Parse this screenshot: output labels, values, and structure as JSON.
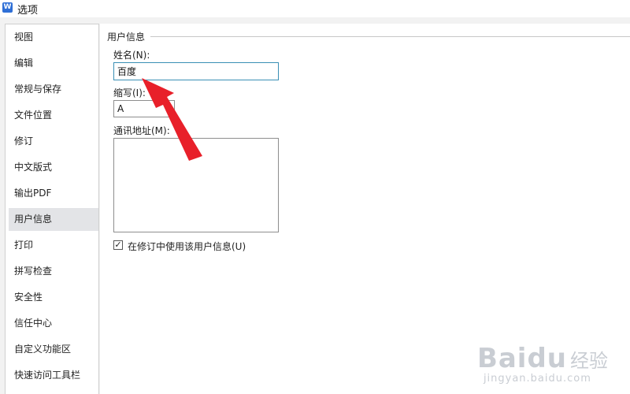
{
  "window": {
    "icon": "W",
    "title": "选项"
  },
  "sidebar": {
    "items": [
      {
        "label": "视图"
      },
      {
        "label": "编辑"
      },
      {
        "label": "常规与保存"
      },
      {
        "label": "文件位置"
      },
      {
        "label": "修订"
      },
      {
        "label": "中文版式"
      },
      {
        "label": "输出PDF"
      },
      {
        "label": "用户信息",
        "selected": true
      },
      {
        "label": "打印"
      },
      {
        "label": "拼写检查"
      },
      {
        "label": "安全性"
      },
      {
        "label": "信任中心"
      },
      {
        "label": "自定义功能区"
      },
      {
        "label": "快速访问工具栏"
      }
    ]
  },
  "user_info": {
    "group_title": "用户信息",
    "name_label": "姓名(N):",
    "name_value": "百度",
    "initials_label": "缩写(I):",
    "initials_value": "A",
    "address_label": "通讯地址(M):",
    "address_value": "",
    "use_info_label": "在修订中使用该用户信息(U)",
    "use_info_checked": true,
    "check_mark": "✓"
  },
  "annotation": {
    "arrow_color": "#e8202a"
  },
  "watermark": {
    "logo": "Bai",
    "logo2": "du",
    "cn": "经验",
    "url": "jingyan.baidu.com"
  }
}
